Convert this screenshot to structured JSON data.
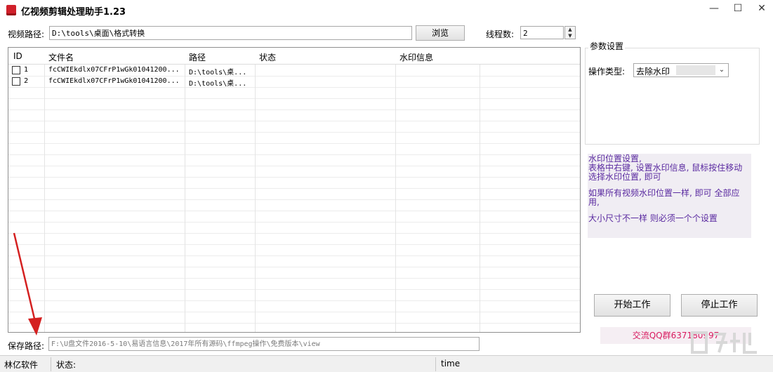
{
  "window": {
    "title": "亿视频剪辑处理助手1.23",
    "min": "—",
    "max": "☐",
    "close": "✕"
  },
  "top": {
    "video_path_label": "视频路径:",
    "video_path_value": "D:\\tools\\桌面\\格式转换",
    "browse": "浏览",
    "threads_label": "线程数:",
    "threads_value": "2"
  },
  "table": {
    "columns": [
      "ID",
      "文件名",
      "路径",
      "状态",
      "水印信息"
    ],
    "rows": [
      {
        "id": "1",
        "file": "fcCWIEkdlx07CFrP1wGk01041200...",
        "path": "D:\\tools\\桌...",
        "status": "",
        "watermark": ""
      },
      {
        "id": "2",
        "file": "fcCWIEkdlx07CFrP1wGk01041200...",
        "path": "D:\\tools\\桌...",
        "status": "",
        "watermark": ""
      }
    ]
  },
  "params": {
    "group_title": "参数设置",
    "op_label": "操作类型:",
    "op_value": "去除水印"
  },
  "hint": {
    "p1": "水印位置设置,\n表格中右键, 设置水印信息, 鼠标按住移动选择水印位置, 即可",
    "p2": "如果所有视频水印位置一样, 即可 全部应用,",
    "p3": "大小尺寸不一样 则必须一个个设置"
  },
  "buttons": {
    "start": "开始工作",
    "stop": "停止工作"
  },
  "qq": "交流QQ群637180997",
  "save": {
    "label": "保存路径:",
    "value": "F:\\U盘文件2016-5-10\\易语言信息\\2017年所有源码\\ffmpeg操作\\免费版本\\view"
  },
  "status": {
    "company": "林亿软件",
    "state_label": "状态:",
    "time": "time"
  },
  "colors": {
    "hint_text": "#5a2aa0",
    "qq_text": "#d81b60",
    "arrow": "#d42020"
  }
}
